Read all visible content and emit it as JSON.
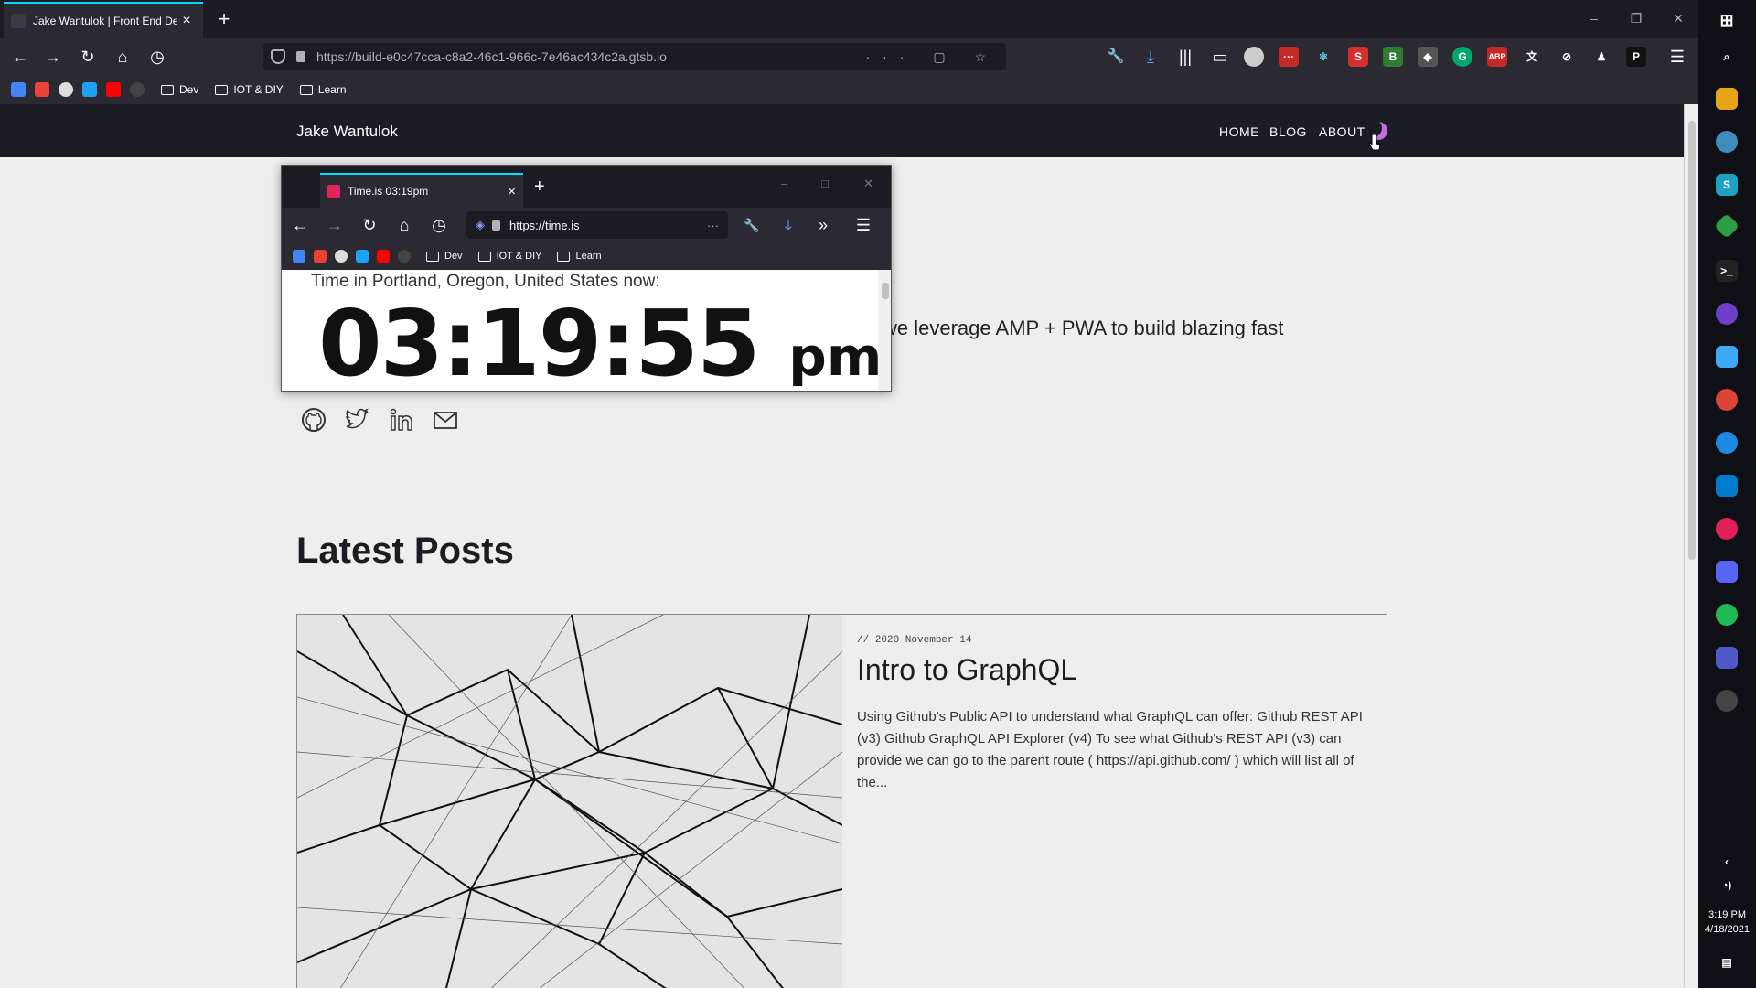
{
  "browser": {
    "tab_title": "Jake Wantulok | Front End Dev...",
    "url": "https://build-e0c47cca-c8a2-46c1-966c-7e46ac434c2a.gtsb.io",
    "url_actions": "··· ▢ ☆",
    "window_controls": [
      "–",
      "❐",
      "✕"
    ],
    "bookmarks": [
      "Dev",
      "IOT & DIY",
      "Learn"
    ]
  },
  "site": {
    "title": "Jake Wantulok",
    "nav": [
      "HOME",
      "BLOG",
      "ABOUT"
    ],
    "hero_text": "we leverage AMP + PWA to build blazing fast",
    "section_heading": "Latest Posts",
    "post": {
      "date": "// 2020 November 14",
      "title": "Intro to GraphQL",
      "excerpt": "Using Github's Public API to understand what GraphQL can offer: Github REST API (v3) Github GraphQL API Explorer (v4) To see what Github's REST API (v3) can provide we can go to the parent route ( https://api.github.com/ ) which will list all of the..."
    },
    "social_icons": [
      "github-icon",
      "twitter-icon",
      "linkedin-icon",
      "mail-icon"
    ]
  },
  "popup": {
    "tab_title": "Time.is 03:19pm",
    "url": "https://time.is",
    "bookmarks": [
      "Dev",
      "IOT & DIY",
      "Learn"
    ],
    "location": "Time in Portland, Oregon, United States now:",
    "time": "03:19:55",
    "ampm": "pm"
  },
  "taskbar": {
    "time": "3:19 PM",
    "date": "4/18/2021"
  },
  "colors": {
    "accent": "#00ddff",
    "moon": "#c66be3",
    "site_header": "#1c1d24",
    "page_bg": "#eeeeee"
  }
}
